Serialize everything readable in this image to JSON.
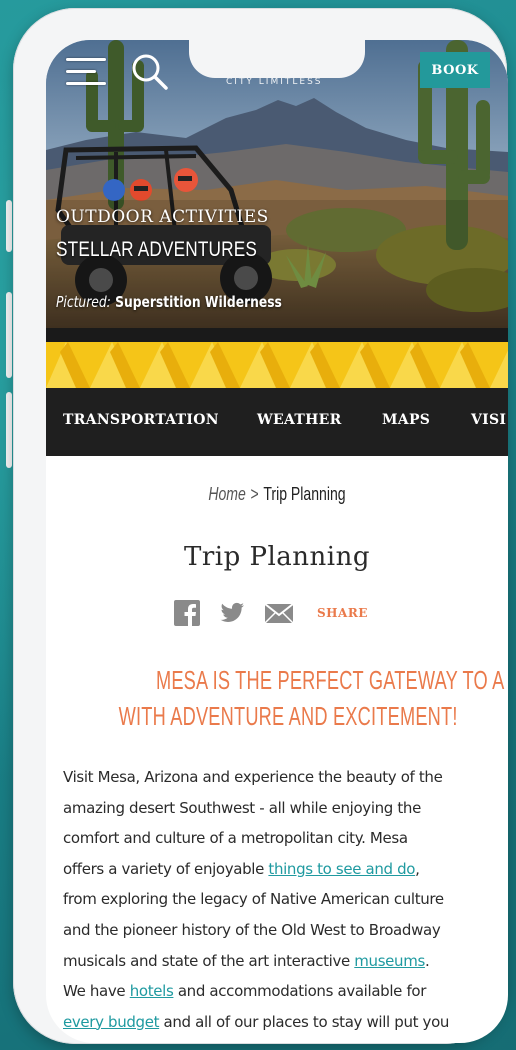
{
  "header": {
    "brand": "CITY LIMITLESS",
    "book_label": "BOOK"
  },
  "hero": {
    "eyebrow": "OUTDOOR ACTIVITIES",
    "title": "STELLAR ADVENTURES",
    "pictured_prefix": "Pictured:",
    "pictured_place": "Superstition Wilderness"
  },
  "nav": {
    "items": [
      "TRANSPORTATION",
      "WEATHER",
      "MAPS",
      "VISI"
    ]
  },
  "breadcrumb": {
    "home": "Home",
    "separator": ">",
    "current": "Trip Planning"
  },
  "page": {
    "title": "Trip Planning",
    "share_label": "SHARE",
    "headline": [
      "MESA IS THE PERFECT GATEWAY TO A VACATION FILLED",
      "WITH ADVENTURE AND EXCITEMENT!"
    ],
    "body": {
      "l1": "Visit Mesa, Arizona and experience the beauty of the",
      "l2": "amazing desert Southwest - all while enjoying the",
      "l3": "comfort and culture of a metropolitan city. Mesa",
      "l4_a": "offers a variety of enjoyable ",
      "l4_link": "things to see and do",
      "l4_b": ",",
      "l5": "from exploring the legacy of Native American culture",
      "l6": "and the pioneer history of the Old West to Broadway",
      "l7_a": "musicals and state of the art interactive ",
      "l7_link": "museums",
      "l7_b": ".",
      "l8_a": "We have ",
      "l8_link": "hotels",
      "l8_b": " and accommodations available for",
      "l9_link": "every budget",
      "l9_b": " and all of our places to stay will put you"
    }
  },
  "colors": {
    "accent_teal": "#23999b",
    "accent_orange": "#ea7a4b",
    "pattern_yellow": "#f5c518",
    "nav_bg": "#1f1f1f"
  },
  "icons": {
    "menu": "hamburger-icon",
    "search": "search-icon",
    "facebook": "facebook-icon",
    "twitter": "twitter-icon",
    "email": "email-icon"
  }
}
